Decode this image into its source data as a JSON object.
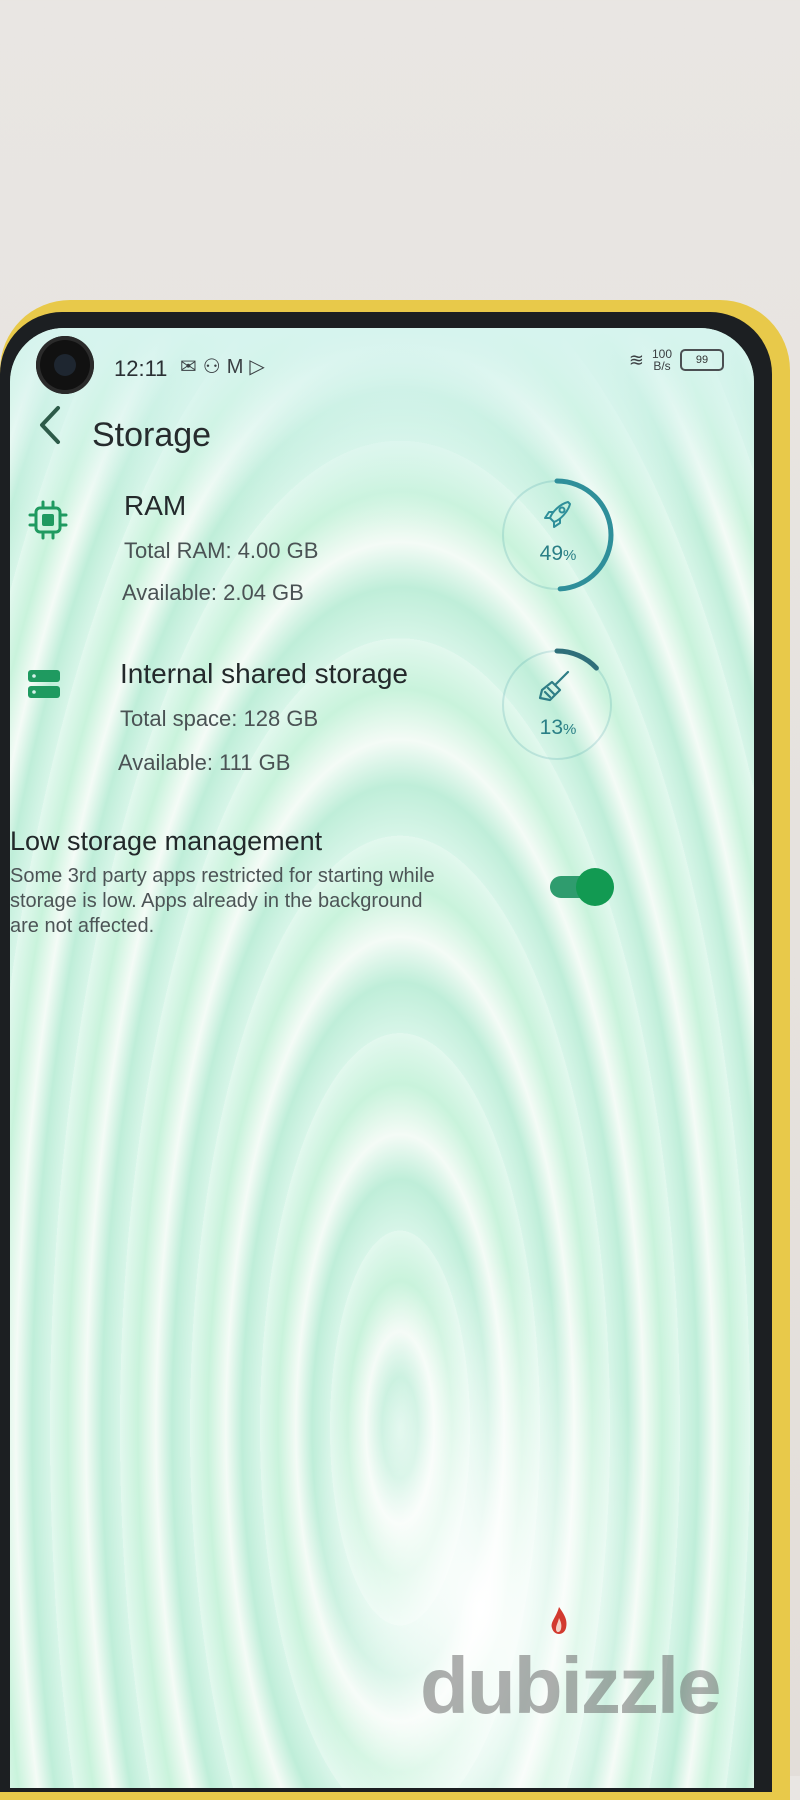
{
  "status_bar": {
    "time": "12:11",
    "left_icons": [
      "mail-icon",
      "person-icon",
      "gmail-icon",
      "play-icon"
    ],
    "net_speed_value": "100",
    "net_speed_unit": "B/s",
    "battery_level": "99"
  },
  "toolbar": {
    "title": "Storage"
  },
  "ram": {
    "title": "RAM",
    "total": "Total RAM: 4.00 GB",
    "available": "Available: 2.04 GB",
    "percent_value": "49",
    "percent_sign": "%",
    "usage_fraction": 0.49,
    "icon": "chip-icon",
    "ring_icon": "rocket-icon"
  },
  "storage": {
    "title": "Internal shared storage",
    "total": "Total space: 128 GB",
    "available": "Available: 111 GB",
    "percent_value": "13",
    "percent_sign": "%",
    "usage_fraction": 0.13,
    "icon": "storage-icon",
    "ring_icon": "broom-icon"
  },
  "low_storage": {
    "title": "Low storage management",
    "description": "Some 3rd party apps restricted for starting while storage is low. Apps already in the background are not affected.",
    "enabled": true
  },
  "watermark": {
    "text": "dubizzle"
  },
  "colors": {
    "accent": "#1f9a60",
    "ring": "#2f8f9a",
    "toggle_on": "#129a52"
  }
}
